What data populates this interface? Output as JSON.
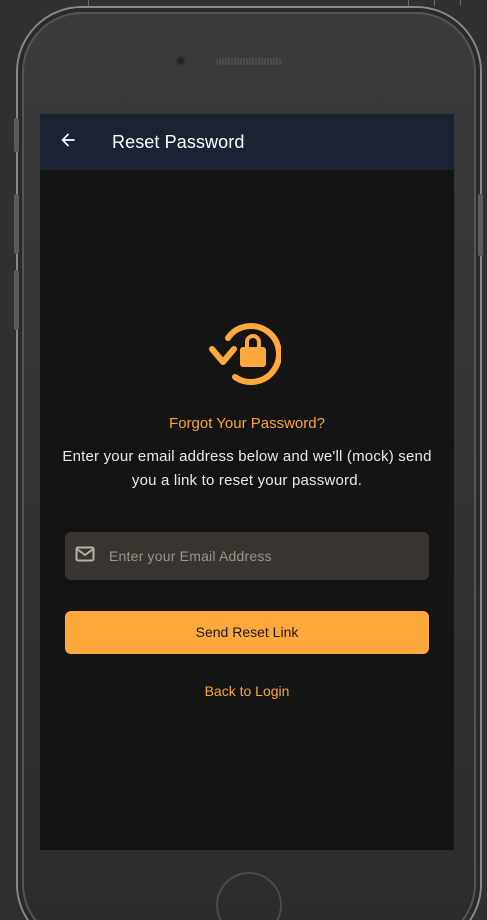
{
  "app_bar": {
    "title": "Reset Password",
    "back_icon": "arrow-left-icon"
  },
  "hero": {
    "icon": "lock-reset-icon",
    "headline": "Forgot Your Password?",
    "description": "Enter your email address below and we'll (mock) send you a link to reset your password."
  },
  "form": {
    "email_icon": "mail-icon",
    "email_placeholder": "Enter your Email Address",
    "email_value": "",
    "send_button_label": "Send Reset Link",
    "back_to_login_label": "Back to Login"
  },
  "colors": {
    "accent": "#ffa83c",
    "app_bar_background": "#1b2333",
    "screen_background": "#141414",
    "input_background": "#39342f",
    "text_primary": "#eaeaea"
  }
}
